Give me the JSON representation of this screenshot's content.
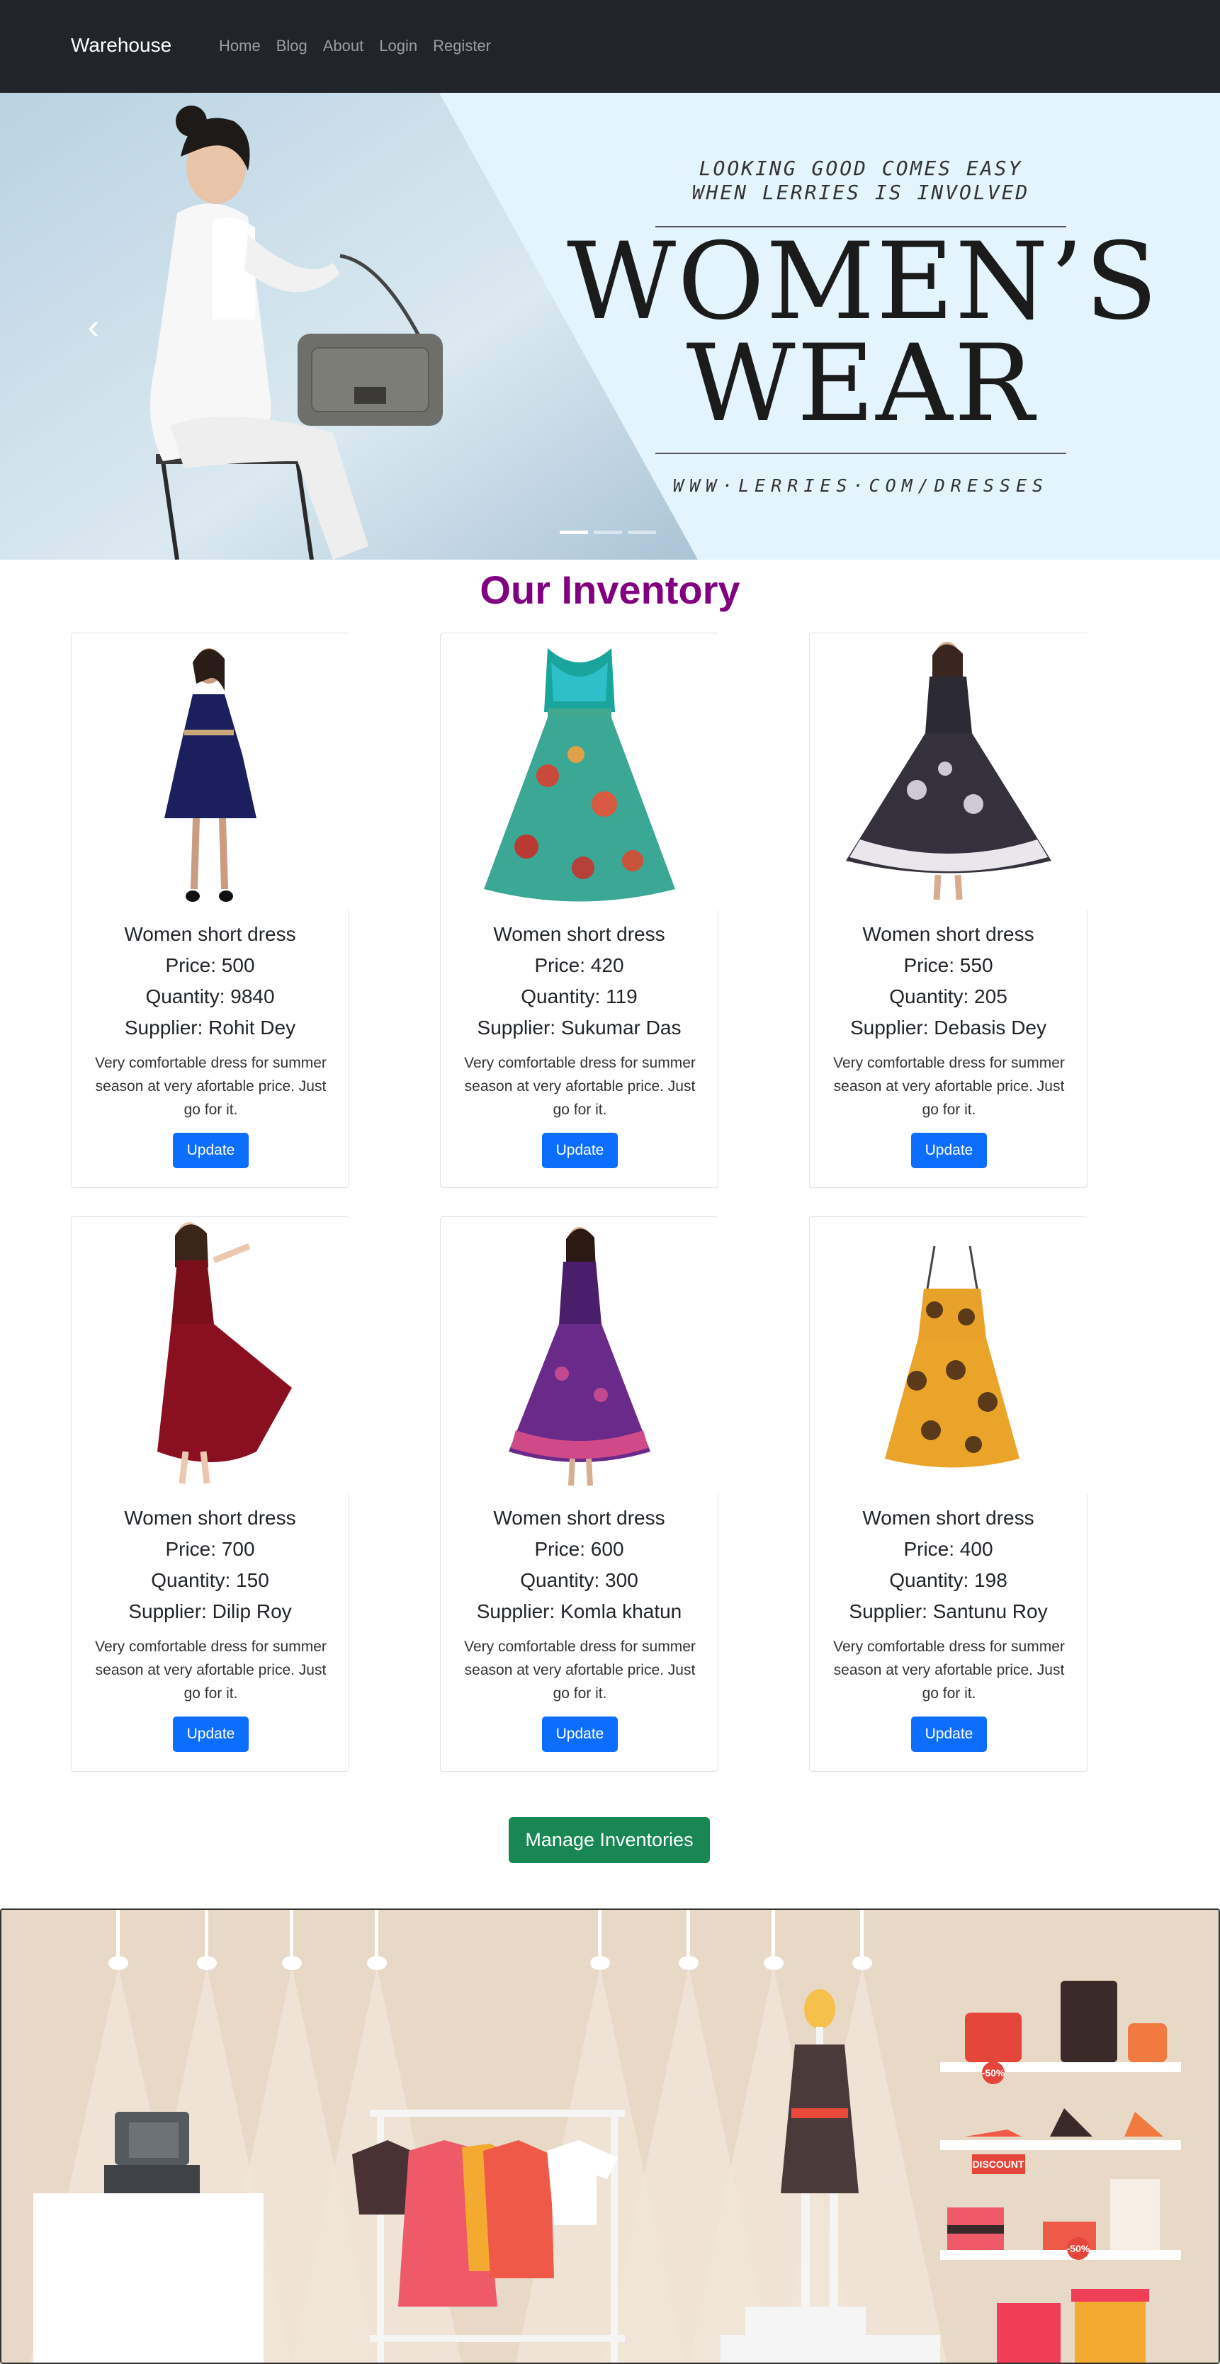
{
  "navbar": {
    "brand": "Warehouse",
    "links": [
      "Home",
      "Blog",
      "About",
      "Login",
      "Register"
    ]
  },
  "hero": {
    "tagline_1": "LOOKING GOOD COMES EASY",
    "tagline_2": "WHEN LERRIES IS INVOLVED",
    "headline_1": "WOMEN’S",
    "headline_2": "WEAR",
    "url": "WWW·LERRIES·COM/DRESSES",
    "prev_icon": "chevron-left-icon",
    "slides": 3,
    "active_slide": 1
  },
  "inventory": {
    "title": "Our Inventory",
    "items": [
      {
        "name": "Women short dress",
        "price": "Price: 500",
        "quantity": "Quantity: 9840",
        "supplier": "Supplier: Rohit Dey",
        "description": "Very comfortable dress for summer season at very afortable price. Just go for it.",
        "button": "Update"
      },
      {
        "name": "Women short dress",
        "price": "Price: 420",
        "quantity": "Quantity: 119",
        "supplier": "Supplier: Sukumar Das",
        "description": "Very comfortable dress for summer season at very afortable price. Just go for it.",
        "button": "Update"
      },
      {
        "name": "Women short dress",
        "price": "Price: 550",
        "quantity": "Quantity: 205",
        "supplier": "Supplier: Debasis Dey",
        "description": "Very comfortable dress for summer season at very afortable price. Just go for it.",
        "button": "Update"
      },
      {
        "name": "Women short dress",
        "price": "Price: 700",
        "quantity": "Quantity: 150",
        "supplier": "Supplier: Dilip Roy",
        "description": "Very comfortable dress for summer season at very afortable price. Just go for it.",
        "button": "Update"
      },
      {
        "name": "Women short dress",
        "price": "Price: 600",
        "quantity": "Quantity: 300",
        "supplier": "Supplier: Komla khatun",
        "description": "Very comfortable dress for summer season at very afortable price. Just go for it.",
        "button": "Update"
      },
      {
        "name": "Women short dress",
        "price": "Price: 400",
        "quantity": "Quantity: 198",
        "supplier": "Supplier: Santunu Roy",
        "description": "Very comfortable dress for summer season at very afortable price. Just go for it.",
        "button": "Update"
      }
    ],
    "manage_button": "Manage Inventories"
  },
  "store_banner": {
    "badge_1": "-50%",
    "badge_2": "DISCOUNT",
    "badge_3": "-50%"
  },
  "colors": {
    "navbar": "#212529",
    "title": "#800080",
    "primary": "#0d6efd",
    "success": "#198754"
  }
}
